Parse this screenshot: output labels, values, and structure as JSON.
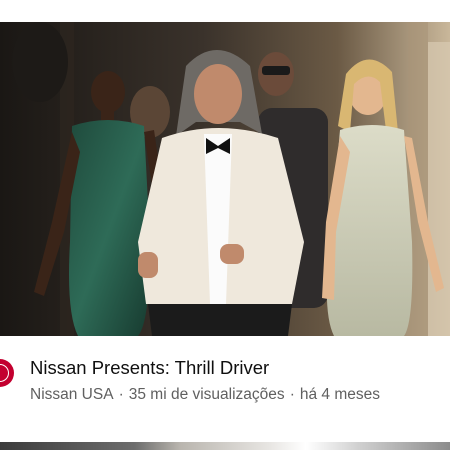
{
  "video": {
    "title": "Nissan Presents: Thrill Driver",
    "channel": "Nissan USA",
    "views": "35 mi de visualizações",
    "age": "há 4 meses",
    "separator": "·"
  },
  "thumbnail_icon": "video-thumbnail",
  "avatar_icon": "nissan-logo-icon",
  "colors": {
    "brand": "#c3002f",
    "meta_text": "#606060",
    "title_text": "#0f0f0f"
  }
}
